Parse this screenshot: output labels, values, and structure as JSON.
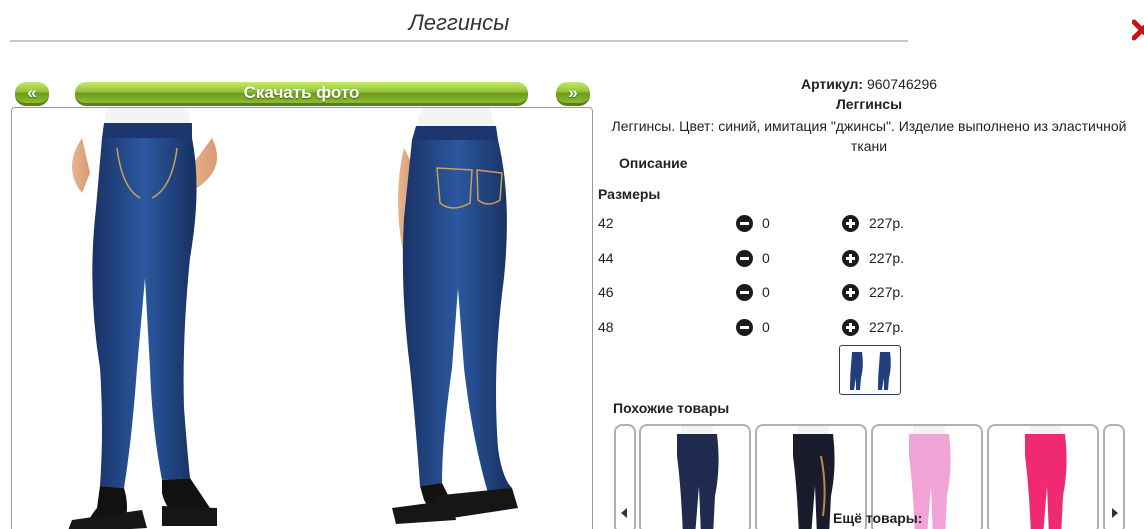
{
  "page": {
    "title": "Леггинсы"
  },
  "nav": {
    "prev_label": "«",
    "next_label": "»",
    "download_label": "Скачать фото"
  },
  "product": {
    "article_label": "Артикул:",
    "article_value": "960746296",
    "name": "Леггинсы",
    "description": "Леггинсы. Цвет: синий, имитация \"джинсы\". Изделие выполнено из эластичной ткани",
    "description_label": "Описание",
    "sizes_label": "Размеры",
    "sizes": [
      {
        "size": "42",
        "qty": "0",
        "price": "227р."
      },
      {
        "size": "44",
        "qty": "0",
        "price": "227р."
      },
      {
        "size": "46",
        "qty": "0",
        "price": "227р."
      },
      {
        "size": "48",
        "qty": "0",
        "price": "227р."
      }
    ]
  },
  "similar": {
    "label": "Похожие товары",
    "items": [
      {
        "color": "#1f2a4e",
        "name": "navy-leggings"
      },
      {
        "color": "#1b1c2b",
        "name": "black-print-leggings"
      },
      {
        "color": "#f2a3d6",
        "name": "pink-leggings"
      },
      {
        "color": "#f02a72",
        "name": "fuchsia-leggings"
      }
    ]
  },
  "more": {
    "label": "Ещё товары:"
  },
  "colors": {
    "accent_green": "#7fb32a",
    "denim": "#1f3f7a",
    "close_red": "#cc1111"
  },
  "icons": [
    "close-icon",
    "minus-circle-icon",
    "plus-circle-icon",
    "arrow-left-icon",
    "arrow-right-icon"
  ]
}
